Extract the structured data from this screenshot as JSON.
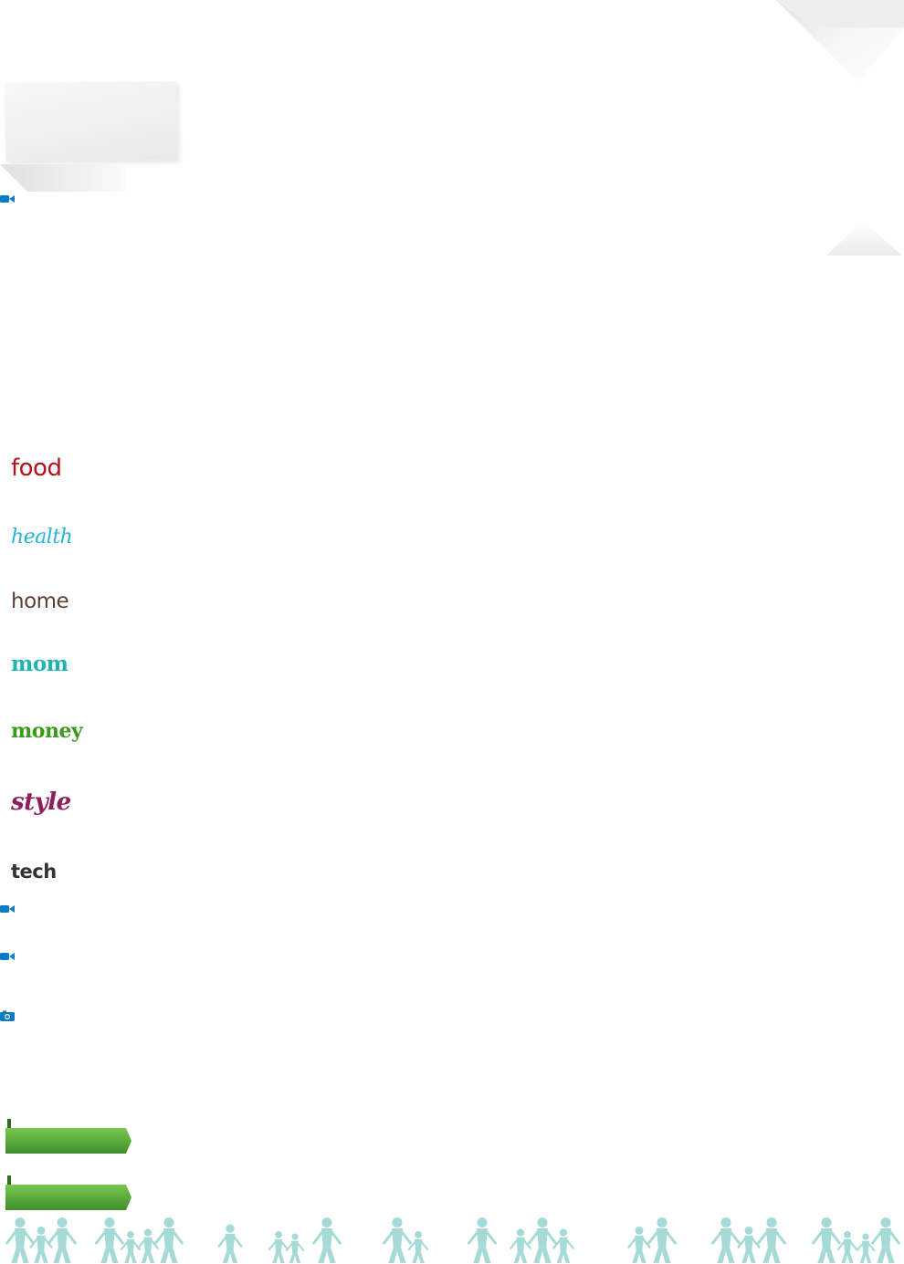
{
  "categories": [
    {
      "id": "food",
      "label": "food",
      "color": "#b5121b"
    },
    {
      "id": "health",
      "label": "health",
      "color": "#25b5d8"
    },
    {
      "id": "home",
      "label": "home",
      "color": "#5a3f33"
    },
    {
      "id": "mom",
      "label": "mom",
      "color": "#1fb3b5"
    },
    {
      "id": "money",
      "label": "money",
      "color": "#3a9a1a"
    },
    {
      "id": "style",
      "label": "style",
      "color": "#8e1f5a"
    },
    {
      "id": "tech",
      "label": "tech",
      "color": "#333333"
    }
  ],
  "icons": {
    "video": "video-camera-icon",
    "photo": "camera-icon",
    "people": "family-silhouettes"
  },
  "colors": {
    "media_icon": "#0a7bc4",
    "ribbon_light": "#6cc04a",
    "ribbon_dark": "#3f8e2a",
    "people": "#a6dad6",
    "paper_fold": "#e4e4e4"
  }
}
